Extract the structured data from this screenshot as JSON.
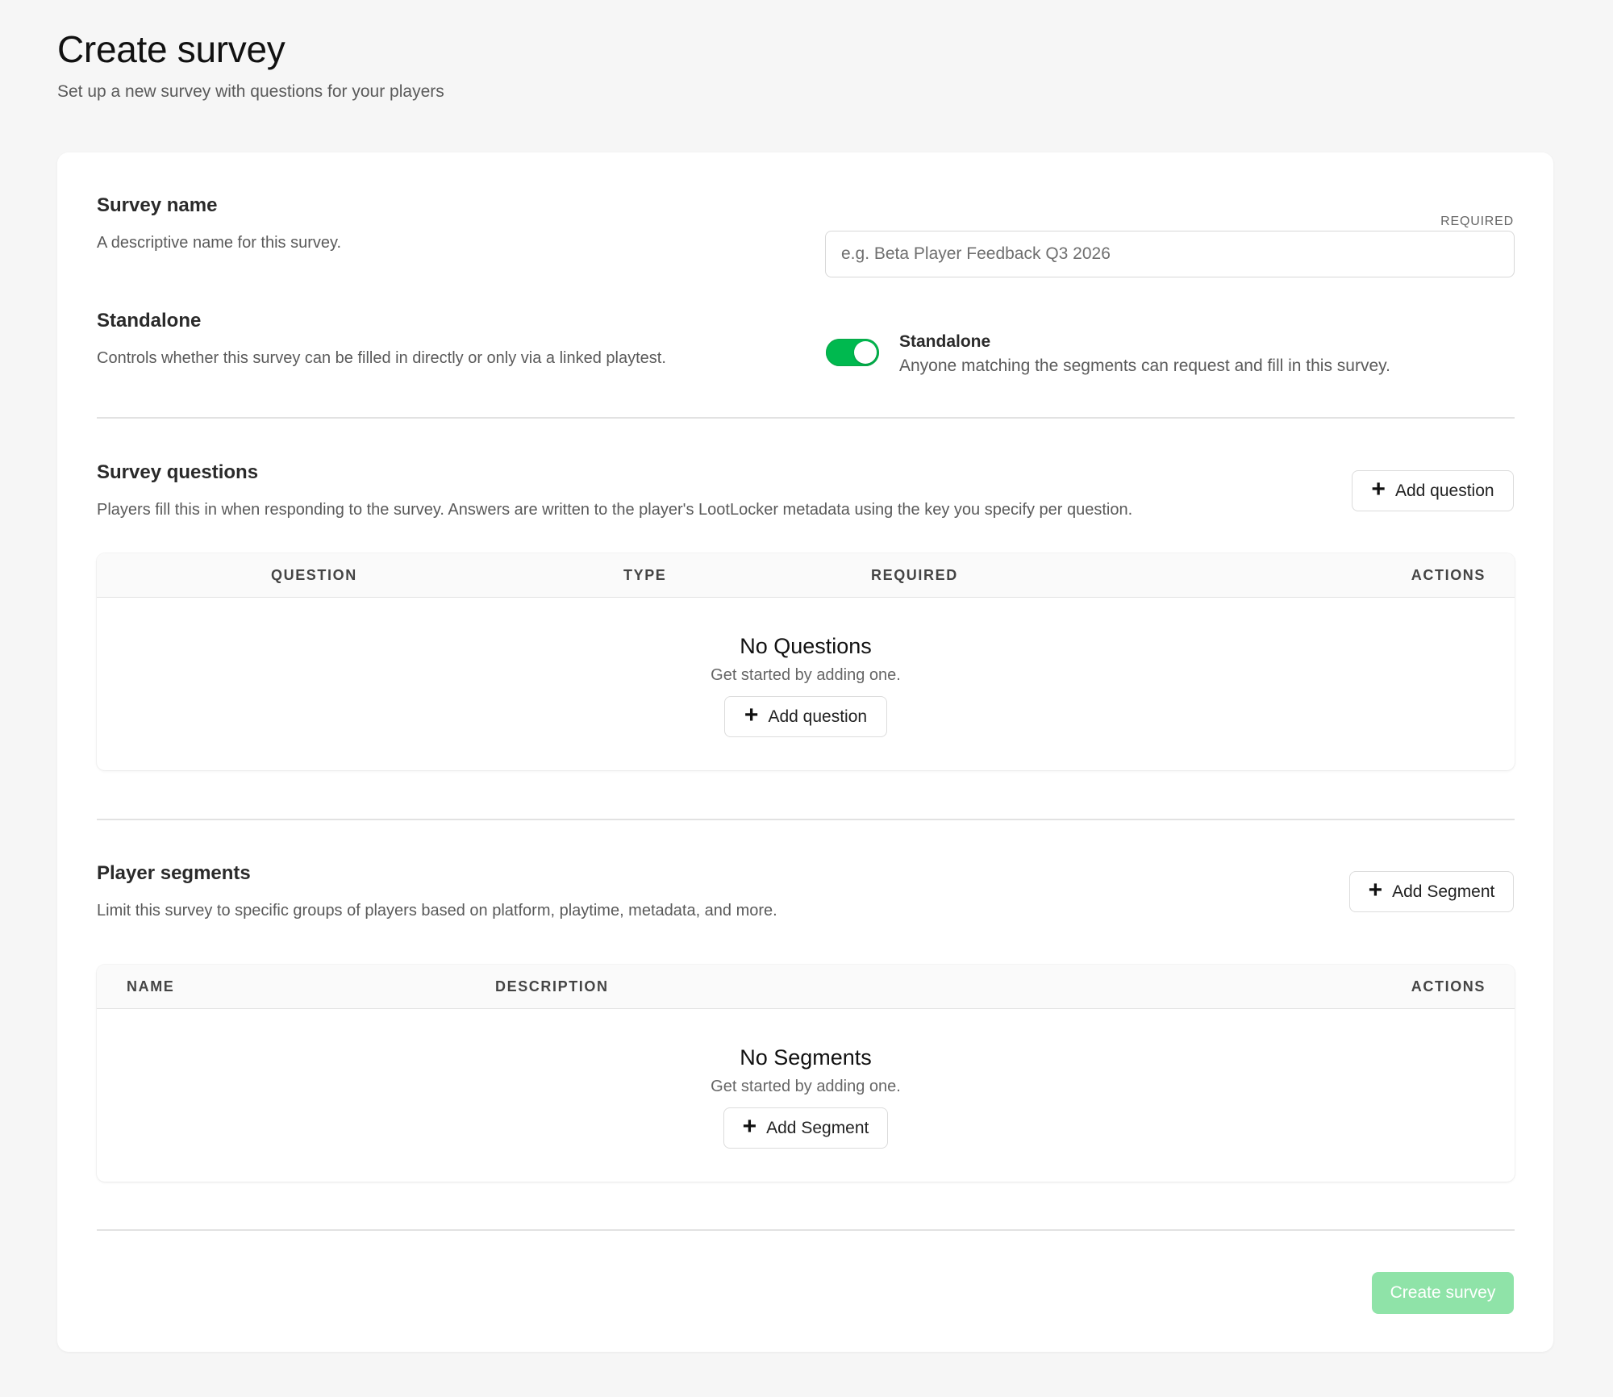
{
  "header": {
    "title": "Create survey",
    "subtitle": "Set up a new survey with questions for your players"
  },
  "survey_name": {
    "title": "Survey name",
    "description": "A descriptive name for this survey.",
    "required_label": "REQUIRED",
    "placeholder": "e.g. Beta Player Feedback Q3 2026",
    "value": ""
  },
  "standalone": {
    "title": "Standalone",
    "description": "Controls whether this survey can be filled in directly or only via a linked playtest.",
    "toggle_on": true,
    "toggle_title": "Standalone",
    "toggle_description": "Anyone matching the segments can request and fill in this survey."
  },
  "questions": {
    "title": "Survey questions",
    "description": "Players fill this in when responding to the survey. Answers are written to the player's LootLocker metadata using the key you specify per question.",
    "add_label": "Add question",
    "columns": [
      "QUESTION",
      "TYPE",
      "REQUIRED",
      "ACTIONS"
    ],
    "empty_title": "No Questions",
    "empty_subtitle": "Get started by adding one.",
    "empty_button": "Add question"
  },
  "segments": {
    "title": "Player segments",
    "description": "Limit this survey to specific groups of players based on platform, playtime, metadata, and more.",
    "add_label": "Add Segment",
    "columns": [
      "NAME",
      "DESCRIPTION",
      "ACTIONS"
    ],
    "empty_title": "No Segments",
    "empty_subtitle": "Get started by adding one.",
    "empty_button": "Add Segment"
  },
  "footer": {
    "submit_label": "Create survey"
  },
  "colors": {
    "toggle_on": "#00b94f",
    "submit_disabled": "#8fe3a8"
  },
  "icons": {
    "add": "plus-icon"
  }
}
